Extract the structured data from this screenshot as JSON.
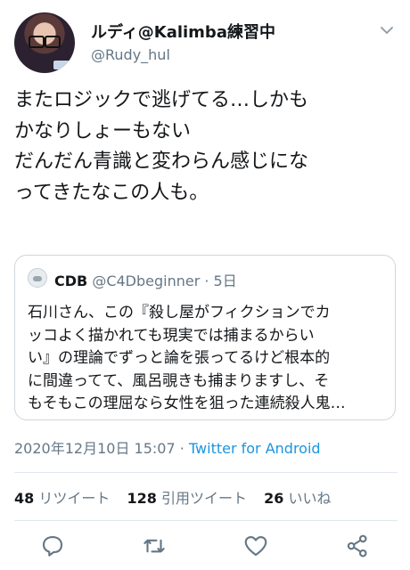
{
  "user": {
    "display_name": "ルディ@Kalimba練習中",
    "handle": "@Rudy_hul"
  },
  "tweet": {
    "lines": [
      "またロジックで逃げてる…しかも",
      "かなりしょーもない",
      "だんだん青識と変わらん感じにな",
      "ってきたなこの人も。"
    ]
  },
  "quote": {
    "name": "CDB",
    "handle_and_time": "@C4Dbeginner · 5日",
    "lines": [
      "石川さん、この『殺し屋がフィクションでカ",
      "ッコよく描かれても現実では捕まるからい",
      "い』の理論でずっと論を張ってるけど根本的",
      "に間違ってて、風呂覗きも捕まりますし、そ",
      "もそもこの理屈なら女性を狙った連続殺人鬼…"
    ]
  },
  "meta": {
    "timestamp": "2020年12月10日 15:07 · ",
    "source": "Twitter for Android"
  },
  "stats": {
    "retweets_count": "48",
    "retweets_label": "リツイート",
    "quotes_count": "128",
    "quotes_label": "引用ツイート",
    "likes_count": "26",
    "likes_label": "いいね"
  },
  "actions": {
    "icons": [
      "reply-icon",
      "retweet-icon",
      "like-icon",
      "share-icon"
    ]
  },
  "colors": {
    "text": "#14171a",
    "secondary": "#657786",
    "link": "#1b95e0",
    "border": "#ccd6dd"
  }
}
